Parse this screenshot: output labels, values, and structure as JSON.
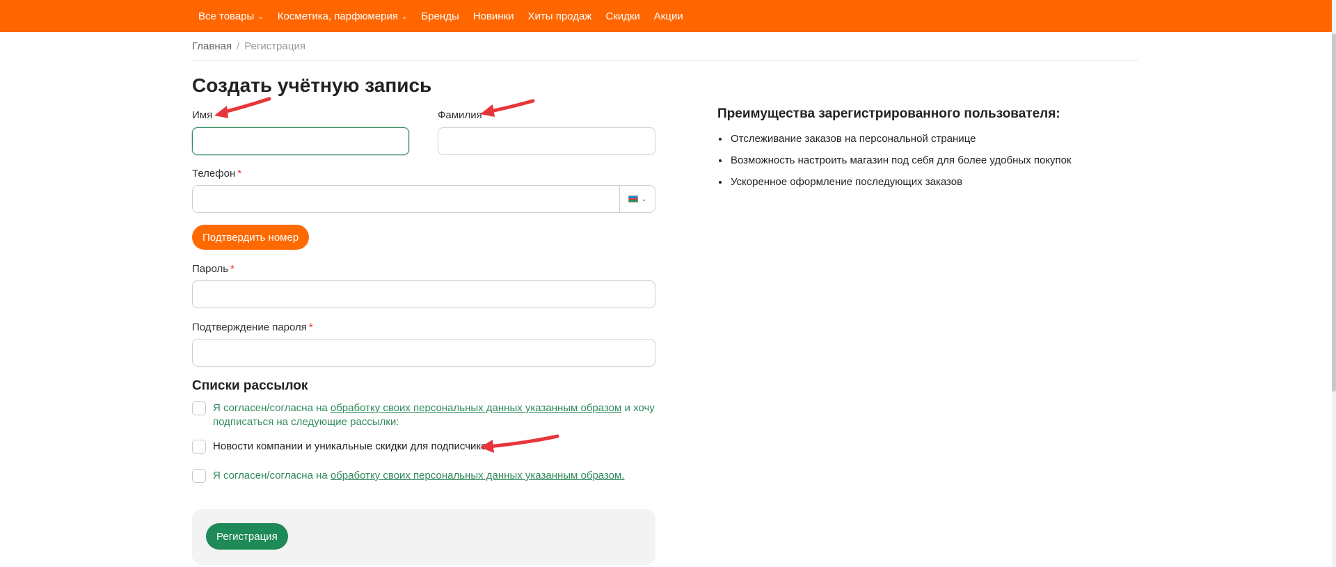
{
  "nav": {
    "items": [
      {
        "label": "Все товары",
        "has_dropdown": true
      },
      {
        "label": "Косметика, парфюмерия",
        "has_dropdown": true
      },
      {
        "label": "Бренды",
        "has_dropdown": false
      },
      {
        "label": "Новинки",
        "has_dropdown": false
      },
      {
        "label": "Хиты продаж",
        "has_dropdown": false
      },
      {
        "label": "Скидки",
        "has_dropdown": false
      },
      {
        "label": "Акции",
        "has_dropdown": false
      }
    ],
    "color": "#ff6600"
  },
  "breadcrumb": {
    "home": "Главная",
    "separator": "/",
    "current": "Регистрация"
  },
  "page_title": "Создать учётную запись",
  "form": {
    "first_name": {
      "label": "Имя",
      "value": "",
      "placeholder": ""
    },
    "last_name": {
      "label": "Фамилия",
      "value": "",
      "placeholder": ""
    },
    "phone": {
      "label": "Телефон",
      "required_mark": "*",
      "value": "",
      "placeholder": "",
      "country_icon": "azerbaijan-flag-icon"
    },
    "verify_button": "Подтвердить номер",
    "password": {
      "label": "Пароль",
      "required_mark": "*",
      "value": ""
    },
    "password_confirm": {
      "label": "Подтверждение пароля",
      "required_mark": "*",
      "value": ""
    }
  },
  "mailing": {
    "title": "Списки рассылок",
    "consent1": {
      "prefix": "Я согласен/согласна на ",
      "link": "обработку своих персональных данных указанным образом",
      "suffix": " и хочу",
      "line2": "подписаться на следующие рассылки:",
      "checked": false
    },
    "newsletter": {
      "label": "Новости компании и уникальные скидки для подписчиков",
      "checked": false
    },
    "consent2": {
      "prefix": "Я согласен/согласна на ",
      "link": "обработку своих персональных данных указанным образом.",
      "checked": false
    }
  },
  "submit_button": "Регистрация",
  "benefits": {
    "title": "Преимущества зарегистрированного пользователя:",
    "items": [
      "Отслеживание заказов на персональной странице",
      "Возможность настроить магазин под себя для более удобных покупок",
      "Ускоренное оформление последующих заказов"
    ]
  },
  "colors": {
    "accent_orange": "#ff6a00",
    "accent_green": "#1e8a57",
    "link_green": "#2f8a5c",
    "annotation_red": "#e8353a"
  }
}
